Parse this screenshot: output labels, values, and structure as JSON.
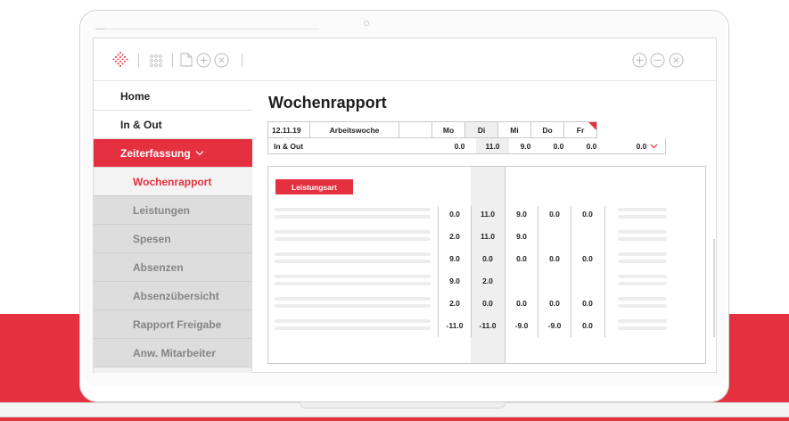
{
  "nav": {
    "items": [
      {
        "label": "Home"
      },
      {
        "label": "In & Out"
      },
      {
        "label": "Zeiterfassung"
      },
      {
        "label": "Wochenrapport"
      },
      {
        "label": "Leistungen"
      },
      {
        "label": "Spesen"
      },
      {
        "label": "Absenzen"
      },
      {
        "label": "Absenzübersicht"
      },
      {
        "label": "Rapport Freigabe"
      },
      {
        "label": "Anw. Mitarbeiter"
      }
    ]
  },
  "main": {
    "title": "Wochenrapport",
    "header": {
      "date": "12.11.19",
      "week_label": "Arbeitswoche",
      "days": [
        "Mo",
        "Di",
        "Mi",
        "Do",
        "Fr"
      ]
    },
    "inout": {
      "label": "In & Out",
      "values": [
        "0.0",
        "11.0",
        "9.0",
        "0.0",
        "0.0"
      ],
      "total": "0.0"
    },
    "leistungsart_button": "Leistungsart",
    "rows": [
      [
        "0.0",
        "11.0",
        "9.0",
        "0.0",
        "0.0"
      ],
      [
        "2.0",
        "11.0",
        "9.0",
        "",
        ""
      ],
      [
        "9.0",
        "0.0",
        "0.0",
        "0.0",
        "0.0"
      ],
      [
        "9.0",
        "2.0",
        "",
        "",
        ""
      ],
      [
        "2.0",
        "0.0",
        "0.0",
        "0.0",
        "0.0"
      ],
      [
        "-11.0",
        "-11.0",
        "-9.0",
        "-9.0",
        "0.0"
      ]
    ]
  },
  "colors": {
    "accent": "#e5303f",
    "sidebar_bg": "#f1f1f1"
  },
  "icons": [
    "logo-icon",
    "apps-grid-icon",
    "document-icon",
    "add-circle-icon",
    "close-circle-icon",
    "zoom-in-icon",
    "zoom-out-icon",
    "window-close-icon",
    "chevron-down-icon"
  ]
}
